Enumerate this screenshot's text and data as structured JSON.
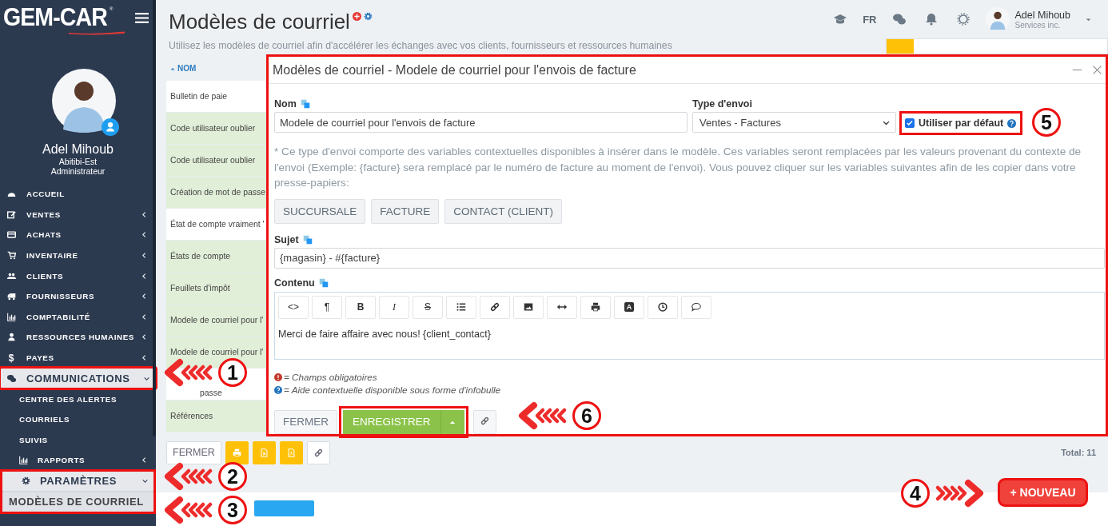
{
  "sidebar": {
    "logo": "GEM-CAR",
    "logo_mark": "®",
    "user": {
      "name": "Adel Mihoub",
      "branch": "Abitibi-Est",
      "role": "Administrateur"
    },
    "menu": [
      {
        "label": "ACCUEIL",
        "selected": false,
        "annotated": false
      },
      {
        "label": "VENTES",
        "expanded": false,
        "selected": false,
        "annotated": false
      },
      {
        "label": "ACHATS",
        "expanded": false,
        "selected": false,
        "annotated": false
      },
      {
        "label": "INVENTAIRE",
        "expanded": false,
        "selected": false,
        "annotated": false
      },
      {
        "label": "CLIENTS",
        "expanded": false,
        "selected": false,
        "annotated": false
      },
      {
        "label": "FOURNISSEURS",
        "expanded": false,
        "selected": false,
        "annotated": false
      },
      {
        "label": "COMPTABILITÉ",
        "expanded": false,
        "selected": false,
        "annotated": false
      },
      {
        "label": "RESSOURCES HUMAINES",
        "expanded": false,
        "selected": false,
        "annotated": false
      },
      {
        "label": "PAYES",
        "glyph": "$",
        "expanded": false,
        "selected": false,
        "annotated": false
      },
      {
        "label": "COMMUNICATIONS",
        "expanded": true,
        "selected": true,
        "annotated": true,
        "children": [
          {
            "label": "CENTRE DES ALERTES",
            "selected": false,
            "annotated": false
          },
          {
            "label": "COURRIELS",
            "selected": false,
            "annotated": false
          },
          {
            "label": "SUIVIS",
            "selected": false,
            "annotated": false
          },
          {
            "label": "RAPPORTS",
            "expanded": false,
            "selected": false,
            "annotated": false
          },
          {
            "label": "PARAMÈTRES",
            "expanded": true,
            "selected": true,
            "annotated": true,
            "children": [
              {
                "label": "MODÈLES DE COURRIEL",
                "selected": true
              }
            ]
          }
        ]
      }
    ]
  },
  "header": {
    "title": "Modèles de courriel",
    "subtitle": "Utilisez les modèles de courriel afin d'accélérer les échanges avec vos clients, fournisseurs et ressources humaines",
    "language": "FR",
    "user": {
      "name": "Adel Mihoub",
      "company": "Services inc."
    }
  },
  "table": {
    "column": "NOM",
    "rows": [
      {
        "name": "Bulletin de paie",
        "tinted": false
      },
      {
        "name": "Code utilisateur oublier",
        "tinted": true
      },
      {
        "name": "Code utilisateur oublier",
        "tinted": true
      },
      {
        "name": "Création de mot de passe",
        "tinted": true
      },
      {
        "name": "État de compte vraiment '",
        "tinted": false
      },
      {
        "name": "États de compte",
        "tinted": true
      },
      {
        "name": "Feuillets d'impôt",
        "tinted": true
      },
      {
        "name": "Modele de courriel pour l'",
        "tinted": true
      },
      {
        "name": "Modele de courriel pour l'",
        "tinted": true
      },
      {
        "name": "passe",
        "tinted": false
      },
      {
        "name": "Références",
        "tinted": true
      }
    ],
    "toolbar": [
      {
        "kind": "text",
        "label": "FERMER"
      },
      {
        "kind": "icon"
      },
      {
        "kind": "icon"
      },
      {
        "kind": "icon"
      },
      {
        "kind": "icon"
      }
    ],
    "total": "Total: 11"
  },
  "new_button": {
    "label": "+ NOUVEAU",
    "annotated": true
  },
  "dialog": {
    "title": "Modèles de courriel - Modele de courriel pour l'envois de facture",
    "annotated": true,
    "name_label": "Nom",
    "name_value": "Modele de courriel pour l'envois de facture",
    "type_label": "Type d'envoi",
    "type_value": "Ventes - Factures",
    "default_option": {
      "label": "Utiliser par défaut",
      "checked": true,
      "annotated": true
    },
    "note": "* Ce type d'envoi comporte des variables contextuelles disponibles à insérer dans le modèle. Ces variables seront remplacées par les valeurs provenant du contexte de l'envoi (Exemple: {facture} sera remplacé par le numéro de facture au moment de l'envoi). Vous pouvez cliquer sur les variables suivantes afin de les copier dans votre presse-papiers:",
    "variables": [
      "SUCCURSALE",
      "FACTURE",
      "CONTACT (CLIENT)"
    ],
    "subject_label": "Sujet",
    "subject_value": "{magasin} - #{facture}",
    "content_label": "Contenu",
    "editor_tools": [
      {
        "kind": "text",
        "label": "<>"
      },
      {
        "kind": "text",
        "label": "¶"
      },
      {
        "kind": "bold",
        "label": "B"
      },
      {
        "kind": "italic",
        "label": "I"
      },
      {
        "kind": "strike",
        "label": "S"
      },
      {
        "kind": "icon"
      },
      {
        "kind": "icon"
      },
      {
        "kind": "icon"
      },
      {
        "kind": "icon"
      },
      {
        "kind": "icon"
      },
      {
        "kind": "boxed",
        "label": "A"
      },
      {
        "kind": "icon"
      },
      {
        "kind": "icon"
      }
    ],
    "content_value": "Merci de faire affaire avec nous! {client_contact}",
    "legend": [
      "= Champs obligatoires",
      "= Aide contextuelle disponible sous forme d'infobulle"
    ],
    "close_label": "FERMER",
    "save_label": "ENREGISTRER",
    "save_annotated": true
  },
  "callouts": [
    {
      "number": "1"
    },
    {
      "number": "2"
    },
    {
      "number": "3"
    },
    {
      "number": "4"
    },
    {
      "number": "5"
    },
    {
      "number": "6"
    }
  ]
}
